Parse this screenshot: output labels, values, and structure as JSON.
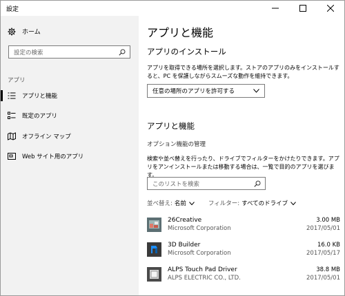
{
  "window": {
    "title": "設定",
    "minimize_glyph": "—",
    "maximize_glyph": "☐",
    "close_glyph": "✕"
  },
  "sidebar": {
    "home_label": "ホーム",
    "search_placeholder": "設定の検索",
    "section_label": "アプリ",
    "items": [
      {
        "label": "アプリと機能",
        "icon": "list-icon",
        "active": true
      },
      {
        "label": "既定のアプリ",
        "icon": "default-apps-icon",
        "active": false
      },
      {
        "label": "オフライン マップ",
        "icon": "map-icon",
        "active": false
      },
      {
        "label": "Web サイト用のアプリ",
        "icon": "web-app-icon",
        "active": false
      }
    ]
  },
  "main": {
    "page_title": "アプリと機能",
    "install_heading": "アプリのインストール",
    "install_description": "アプリを取得できる場所を選択します。ストアのアプリのみをインストールすると、PC を保護しながらスムーズな動作を維持できます。",
    "install_dropdown_value": "任意の場所のアプリを許可する",
    "features_heading": "アプリと機能",
    "optional_features_link": "オプション機能の管理",
    "features_description": "検索や並べ替えを行ったり、ドライブでフィルターをかけたりできます。アプリをアンインストールまたは移動する場合は、一覧で目的のアプリを選びます。",
    "list_search_placeholder": "このリストを検索",
    "sort_label": "並べ替え:",
    "sort_value": "名前",
    "filter_label": "フィルター:",
    "filter_value": "すべてのドライブ",
    "apps": [
      {
        "name": "26Creative",
        "publisher": "Microsoft Corporation",
        "size": "3.00 MB",
        "date": "2017/05/01",
        "icon": "creative-app-icon"
      },
      {
        "name": "3D Builder",
        "publisher": "Microsoft Corporation",
        "size": "16.0 KB",
        "date": "2017/05/17",
        "icon": "3d-builder-icon"
      },
      {
        "name": "ALPS Touch Pad Driver",
        "publisher": "ALPS ELECTRIC CO., LTD.",
        "size": "38.8 MB",
        "date": "2017/05/01",
        "icon": "driver-icon"
      }
    ]
  },
  "colors": {
    "sidebar_bg": "#f2f2f2",
    "accent_3d": "#0078d7"
  }
}
